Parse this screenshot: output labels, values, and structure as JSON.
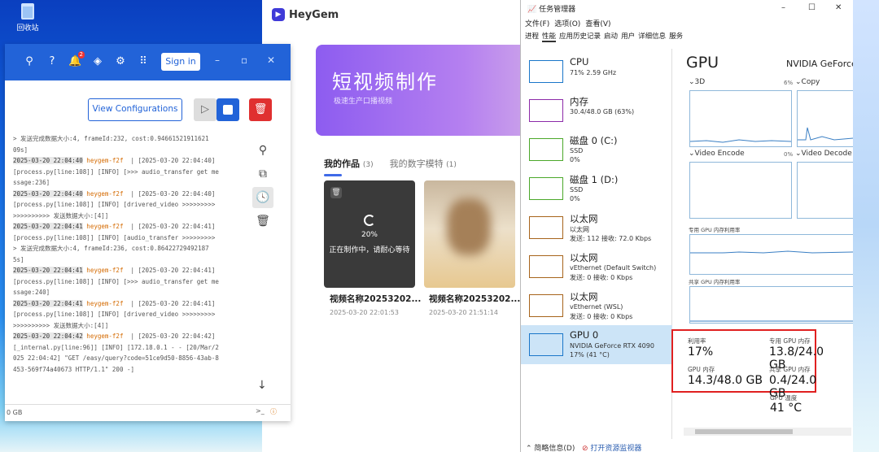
{
  "desktop": {
    "recycle_label": "回收站"
  },
  "heygem": {
    "logo": "HeyGem",
    "banner_title": "短视频制作",
    "banner_sub": "极速生产口播视频",
    "tab_works": "我的作品",
    "tab_works_count": "(3)",
    "tab_models": "我的数字模特",
    "tab_models_count": "(1)",
    "cards": [
      {
        "progress": "20%",
        "status": "正在制作中，请耐心等待",
        "name": "视频名称20253202...",
        "date": "2025-03-20 22:01:53"
      },
      {
        "name": "视频名称20253202...",
        "date": "2025-03-20 21:51:14"
      }
    ]
  },
  "logwin": {
    "notif_count": "2",
    "signin": "Sign in",
    "view_config": "View Configurations",
    "footer_left": "0 GB",
    "lines": [
      {
        "plain": "> 发送完成数据大小:4, frameId:232, cost:0.94661521911621"
      },
      {
        "plain": "09s]"
      },
      {
        "ts": "2025-03-20 22:04:40",
        "hy": " heygem-f2f",
        "rest": "  | [2025-03-20 22:04:40]"
      },
      {
        "plain": "[process.py[line:108]] [INFO] [>>> audio_transfer get me"
      },
      {
        "plain": "ssage:236]"
      },
      {
        "ts": "2025-03-20 22:04:40",
        "hy": " heygem-f2f",
        "rest": "  | [2025-03-20 22:04:40]"
      },
      {
        "plain": "[process.py[line:108]] [INFO] [drivered_video >>>>>>>>>"
      },
      {
        "plain": ">>>>>>>>>> 发送数据大小:[4]]"
      },
      {
        "ts": "2025-03-20 22:04:41",
        "hy": " heygem-f2f",
        "rest": "  | [2025-03-20 22:04:41]"
      },
      {
        "plain": "[process.py[line:108]] [INFO] [audio_transfer >>>>>>>>>"
      },
      {
        "plain": "> 发送完成数据大小:4, frameId:236, cost:0.86422729492187"
      },
      {
        "plain": "5s]"
      },
      {
        "ts": "2025-03-20 22:04:41",
        "hy": " heygem-f2f",
        "rest": "  | [2025-03-20 22:04:41]"
      },
      {
        "plain": "[process.py[line:108]] [INFO] [>>> audio_transfer get me"
      },
      {
        "plain": "ssage:240]"
      },
      {
        "ts": "2025-03-20 22:04:41",
        "hy": " heygem-f2f",
        "rest": "  | [2025-03-20 22:04:41]"
      },
      {
        "plain": "[process.py[line:108]] [INFO] [drivered_video >>>>>>>>>"
      },
      {
        "plain": ">>>>>>>>>> 发送数据大小:[4]]"
      },
      {
        "ts": "2025-03-20 22:04:42",
        "hy": " heygem-f2f",
        "rest": "  | [2025-03-20 22:04:42]"
      },
      {
        "plain": "[_internal.py[line:96]] [INFO] [172.18.0.1 - - [20/Mar/2"
      },
      {
        "plain": "025 22:04:42] \"GET /easy/query?code=51ce9d50-8856-43ab-8"
      },
      {
        "plain": "453-569f74a40673 HTTP/1.1\" 200 -]"
      }
    ]
  },
  "taskmgr": {
    "title": "任务管理器",
    "menu": [
      "文件(F)",
      "选项(O)",
      "查看(V)"
    ],
    "tabs": [
      "进程",
      "性能",
      "应用历史记录",
      "启动",
      "用户",
      "详细信息",
      "服务"
    ],
    "items": [
      {
        "name": "CPU",
        "sub1": "71% 2.59 GHz",
        "sub2": "",
        "color": "#1a76c9"
      },
      {
        "name": "内存",
        "sub1": "30.4/48.0 GB (63%)",
        "sub2": "",
        "color": "#8c2aa8"
      },
      {
        "name": "磁盘 0 (C:)",
        "sub1": "SSD",
        "sub2": "0%",
        "color": "#4ba82a"
      },
      {
        "name": "磁盘 1 (D:)",
        "sub1": "SSD",
        "sub2": "0%",
        "color": "#4ba82a"
      },
      {
        "name": "以太网",
        "sub1": "以太网",
        "sub2": "发送: 112 接收: 72.0 Kbps",
        "color": "#a7641b"
      },
      {
        "name": "以太网",
        "sub1": "vEthernet (Default Switch)",
        "sub2": "发送: 0 接收: 0 Kbps",
        "color": "#a7641b"
      },
      {
        "name": "以太网",
        "sub1": "vEthernet (WSL)",
        "sub2": "发送: 0 接收: 0 Kbps",
        "color": "#a7641b"
      },
      {
        "name": "GPU 0",
        "sub1": "NVIDIA GeForce RTX 4090",
        "sub2": "17% (41 °C)",
        "color": "#1a76c9"
      }
    ],
    "gpu": {
      "title": "GPU",
      "model": "NVIDIA GeForce RTX 4090",
      "engines": [
        {
          "name": "3D",
          "pct": "6%"
        },
        {
          "name": "Copy",
          "pct": ""
        },
        {
          "name": "Video Encode",
          "pct": "0%"
        },
        {
          "name": "Video Decode",
          "pct": ""
        }
      ],
      "dedicated_label": "专用 GPU 内存利用率",
      "shared_label": "共享 GPU 内存利用率",
      "util_label": "利用率",
      "util": "17%",
      "ded_label": "专用 GPU 内存",
      "ded": "13.8/24.0 GB",
      "mem_label": "GPU 内存",
      "mem": "14.3/48.0 GB",
      "shared_mem_label": "共享 GPU 内存",
      "shared_mem": "0.4/24.0 GB",
      "temp_label": "GPU 温度",
      "temp": "41 °C"
    },
    "footer_less": "简略信息(D)",
    "footer_monitor": "打开资源监视器"
  }
}
